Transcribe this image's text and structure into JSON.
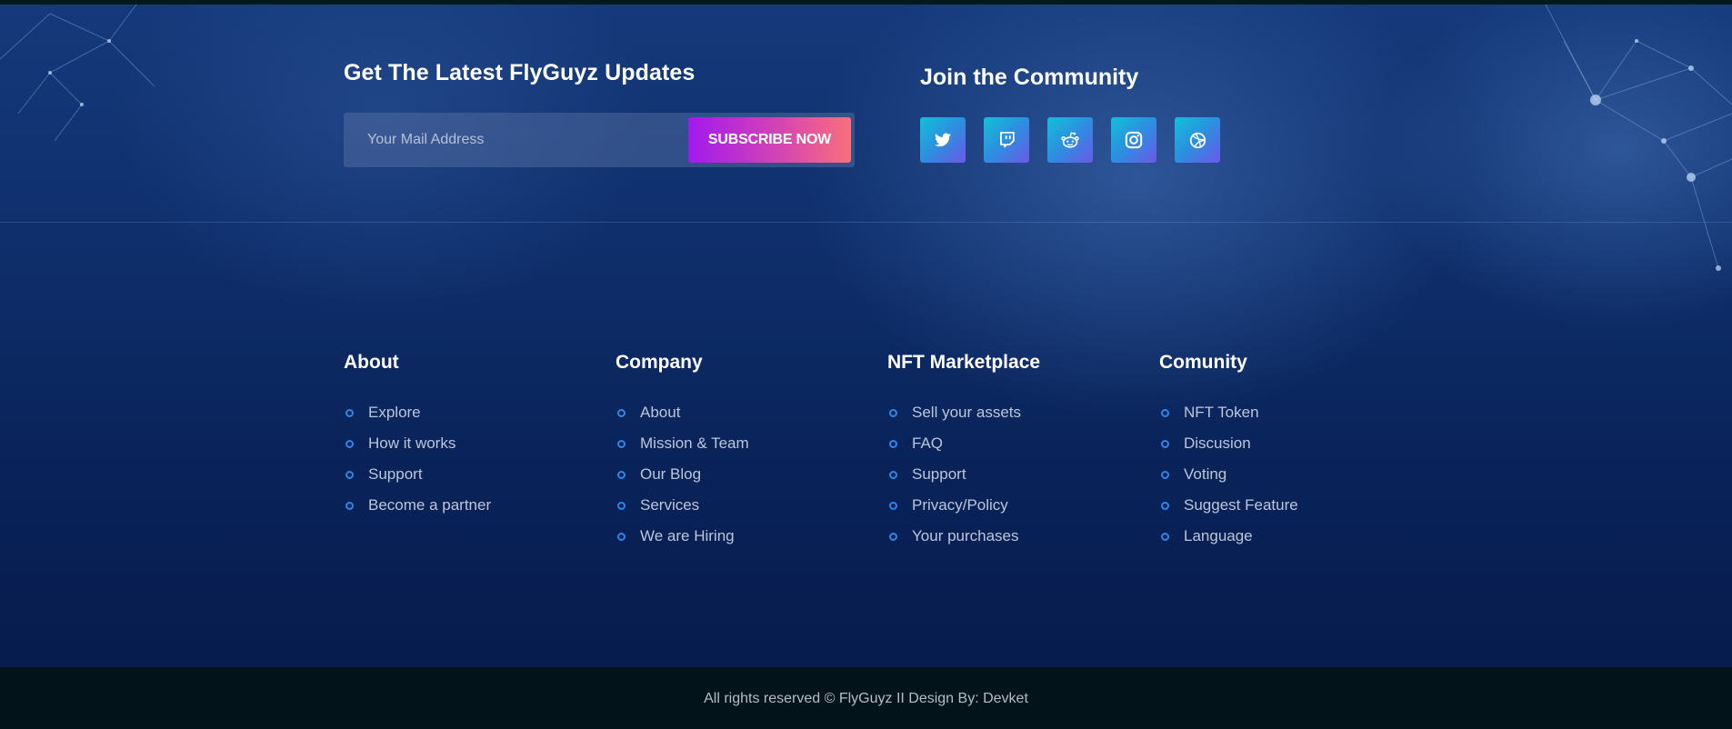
{
  "newsletter": {
    "title": "Get The Latest FlyGuyz Updates",
    "email_placeholder": "Your Mail Address",
    "email_value": "",
    "subscribe_label": "SUBSCRIBE NOW"
  },
  "community": {
    "title": "Join the Community",
    "socials": [
      {
        "icon": "twitter-icon"
      },
      {
        "icon": "twitch-icon"
      },
      {
        "icon": "reddit-icon"
      },
      {
        "icon": "instagram-icon"
      },
      {
        "icon": "dribbble-icon"
      }
    ]
  },
  "columns": [
    {
      "title": "About",
      "items": [
        "Explore",
        "How it works",
        "Support",
        "Become a partner"
      ]
    },
    {
      "title": "Company",
      "items": [
        "About",
        "Mission & Team",
        "Our Blog",
        "Services",
        "We are Hiring"
      ]
    },
    {
      "title": "NFT Marketplace",
      "items": [
        "Sell your assets",
        "FAQ",
        "Support",
        "Privacy/Policy",
        "Your purchases"
      ]
    },
    {
      "title": "Comunity",
      "items": [
        "NFT Token",
        "Discusion",
        "Voting",
        "Suggest Feature",
        "Language"
      ]
    }
  ],
  "footer": {
    "copyright": "All rights reserved © FlyGuyz II Design By: Devket"
  },
  "colors": {
    "background_top": "#15397a",
    "background_bottom": "#071b4d",
    "footer_bar": "#021419",
    "subscribe_gradient_start": "#a219ee",
    "subscribe_gradient_end": "#fa6f7b",
    "social_gradient_start": "#12c0d8",
    "social_gradient_end": "#6c58e8",
    "bullet": "#2f86e6"
  }
}
